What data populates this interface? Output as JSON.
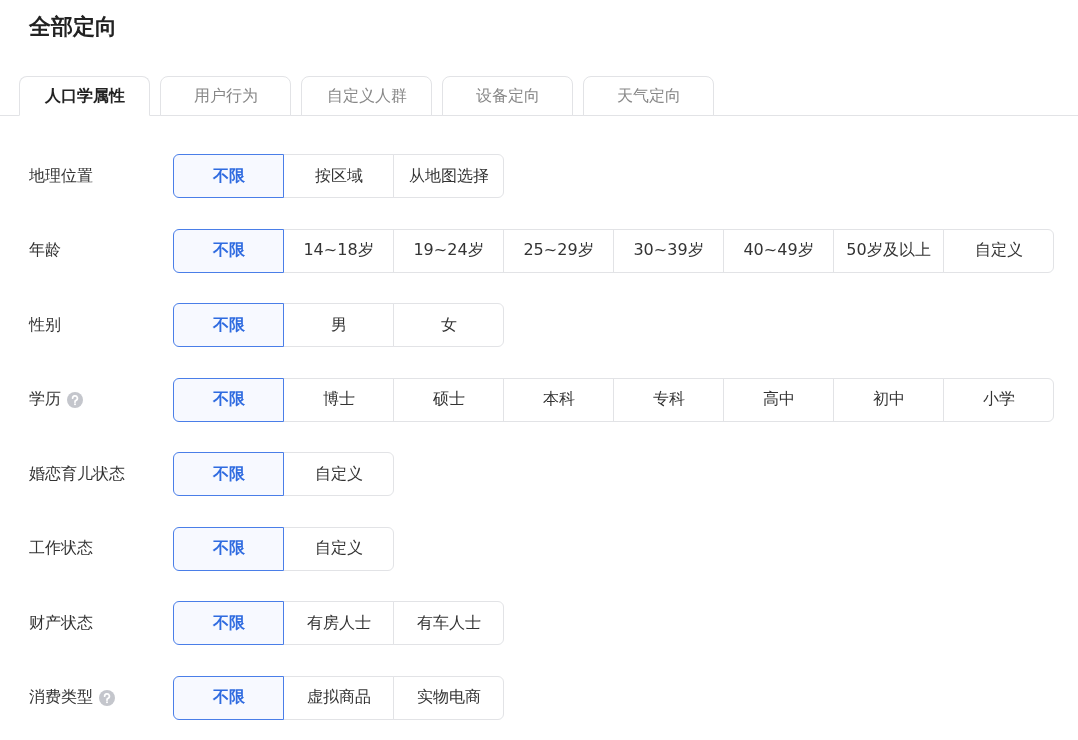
{
  "title": "全部定向",
  "tabs": [
    {
      "label": "人口学属性",
      "selected": true
    },
    {
      "label": "用户行为",
      "selected": false
    },
    {
      "label": "自定义人群",
      "selected": false
    },
    {
      "label": "设备定向",
      "selected": false
    },
    {
      "label": "天气定向",
      "selected": false
    }
  ],
  "rows": [
    {
      "label": "地理位置",
      "help": false,
      "options": [
        {
          "label": "不限",
          "selected": true
        },
        {
          "label": "按区域",
          "selected": false
        },
        {
          "label": "从地图选择",
          "selected": false
        }
      ]
    },
    {
      "label": "年龄",
      "help": false,
      "options": [
        {
          "label": "不限",
          "selected": true
        },
        {
          "label": "14~18岁",
          "selected": false
        },
        {
          "label": "19~24岁",
          "selected": false
        },
        {
          "label": "25~29岁",
          "selected": false
        },
        {
          "label": "30~39岁",
          "selected": false
        },
        {
          "label": "40~49岁",
          "selected": false
        },
        {
          "label": "50岁及以上",
          "selected": false
        },
        {
          "label": "自定义",
          "selected": false
        }
      ]
    },
    {
      "label": "性别",
      "help": false,
      "options": [
        {
          "label": "不限",
          "selected": true
        },
        {
          "label": "男",
          "selected": false
        },
        {
          "label": "女",
          "selected": false
        }
      ]
    },
    {
      "label": "学历",
      "help": true,
      "options": [
        {
          "label": "不限",
          "selected": true
        },
        {
          "label": "博士",
          "selected": false
        },
        {
          "label": "硕士",
          "selected": false
        },
        {
          "label": "本科",
          "selected": false
        },
        {
          "label": "专科",
          "selected": false
        },
        {
          "label": "高中",
          "selected": false
        },
        {
          "label": "初中",
          "selected": false
        },
        {
          "label": "小学",
          "selected": false
        }
      ]
    },
    {
      "label": "婚恋育儿状态",
      "help": false,
      "options": [
        {
          "label": "不限",
          "selected": true
        },
        {
          "label": "自定义",
          "selected": false
        }
      ]
    },
    {
      "label": "工作状态",
      "help": false,
      "options": [
        {
          "label": "不限",
          "selected": true
        },
        {
          "label": "自定义",
          "selected": false
        }
      ]
    },
    {
      "label": "财产状态",
      "help": false,
      "options": [
        {
          "label": "不限",
          "selected": true
        },
        {
          "label": "有房人士",
          "selected": false
        },
        {
          "label": "有车人士",
          "selected": false
        }
      ]
    },
    {
      "label": "消费类型",
      "help": true,
      "options": [
        {
          "label": "不限",
          "selected": true
        },
        {
          "label": "虚拟商品",
          "selected": false
        },
        {
          "label": "实物电商",
          "selected": false
        }
      ]
    }
  ]
}
